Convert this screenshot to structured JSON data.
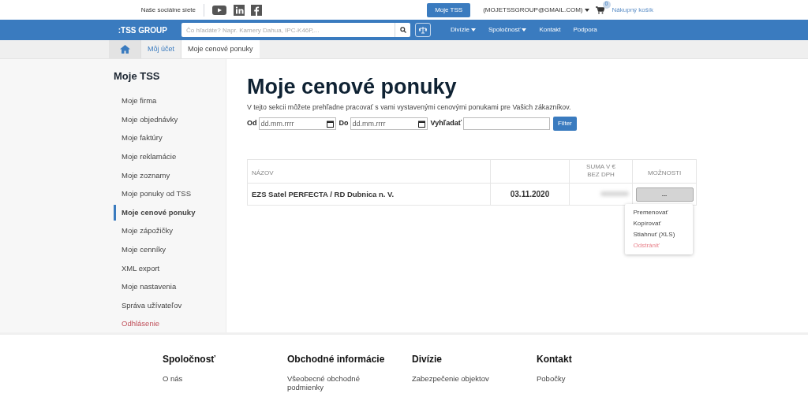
{
  "top_bar": {
    "social_label": "Naše sociálne siete",
    "account_button": "Moje TSS",
    "user_menu": "(MOJETSSGROUP@GMAIL.COM)",
    "cart_count": "0",
    "cart_label": "Nákupný košík"
  },
  "nav": {
    "logo": ":TSS GROUP",
    "search": {
      "placeholder": "Čo hľadáte? Napr. Kamery Dahua, IPC-K46P,..."
    },
    "items": [
      {
        "label": "Divízie",
        "dropdown": true
      },
      {
        "label": "Spoločnosť",
        "dropdown": true
      },
      {
        "label": "Kontakt",
        "dropdown": false
      },
      {
        "label": "Podpora",
        "dropdown": false
      }
    ]
  },
  "breadcrumb": [
    "Môj účet",
    "Moje cenové ponuky"
  ],
  "sidebar": {
    "title": "Moje TSS",
    "items": [
      {
        "label": "Moje firma",
        "selected": false,
        "kind": "link"
      },
      {
        "label": "Moje objednávky",
        "selected": false,
        "kind": "link"
      },
      {
        "label": "Moje faktúry",
        "selected": false,
        "kind": "link"
      },
      {
        "label": "Moje reklamácie",
        "selected": false,
        "kind": "link"
      },
      {
        "label": "Moje zoznamy",
        "selected": false,
        "kind": "link"
      },
      {
        "label": "Moje ponuky od TSS",
        "selected": false,
        "kind": "link"
      },
      {
        "label": "Moje cenové ponuky",
        "selected": true,
        "kind": "link"
      },
      {
        "label": "Moje zápožičky",
        "selected": false,
        "kind": "link"
      },
      {
        "label": "Moje cenníky",
        "selected": false,
        "kind": "link"
      },
      {
        "label": "XML export",
        "selected": false,
        "kind": "link"
      },
      {
        "label": "Moje nastavenia",
        "selected": false,
        "kind": "link"
      },
      {
        "label": "Správa užívateľov",
        "selected": false,
        "kind": "link"
      },
      {
        "label": "Odhlásenie",
        "selected": false,
        "kind": "logout"
      }
    ]
  },
  "main": {
    "title": "Moje cenové ponuky",
    "description": "V tejto sekcii môžete prehľadne pracovať s vami vystavenými cenovými ponukami pre Vašich zákazníkov.",
    "filters": {
      "from_label": "Od",
      "from_placeholder": "dd.mm.rrrr",
      "to_label": "Do",
      "to_placeholder": "dd.mm.rrrr",
      "search_label": "Vyhľadať",
      "button": "Filter"
    },
    "table": {
      "columns": [
        "NÁZOV",
        "SUMA V €\nBEZ DPH",
        "MOŽNOSTI"
      ],
      "rows": [
        {
          "name": "EZS Satel PERFECTA / RD Dubnica n. V.",
          "date": "03.11.2020",
          "options_button": "...",
          "menu_open": true
        }
      ]
    },
    "menu": [
      {
        "label": "Premenovať",
        "kind": "normal"
      },
      {
        "label": "Kopírovať",
        "kind": "normal"
      },
      {
        "label": "Stiahnuť (XLS)",
        "kind": "normal"
      },
      {
        "label": "Odstrániť",
        "kind": "danger"
      }
    ]
  },
  "footer": {
    "columns": [
      {
        "title": "Spoločnosť",
        "links": [
          "O nás"
        ]
      },
      {
        "title": "Obchodné informácie",
        "links": [
          "Všeobecné obchodné podmienky"
        ]
      },
      {
        "title": "Divízie",
        "links": [
          "Zabezpečenie objektov"
        ]
      },
      {
        "title": "Kontakt",
        "links": [
          "Pobočky"
        ]
      }
    ]
  }
}
